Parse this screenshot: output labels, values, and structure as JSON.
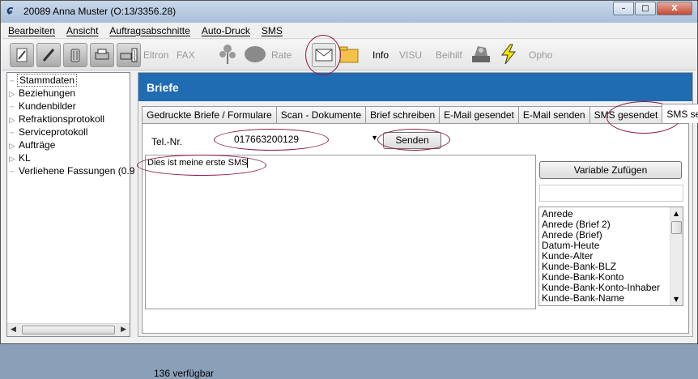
{
  "window": {
    "icon": "ɕ",
    "title": "20089  Anna Muster   (O:13/3356.28)",
    "minimize": "–",
    "maximize": "□",
    "close": "X"
  },
  "menu": [
    "Bearbeiten",
    "Ansicht",
    "Auftragsabschnitte",
    "Auto-Druck",
    "SMS"
  ],
  "toolbar": {
    "elton": "Eltron",
    "fax": "FAX",
    "rate": "Rate",
    "info": "Info",
    "visu": "VISU",
    "beihilf": "Beihilf",
    "opho": "Opho"
  },
  "tree": [
    {
      "label": "Stammdaten",
      "expandable": false,
      "selected": true
    },
    {
      "label": "Beziehungen",
      "expandable": true
    },
    {
      "label": "Kundenbilder",
      "expandable": false
    },
    {
      "label": "Refraktionsprotokoll",
      "expandable": true
    },
    {
      "label": "Serviceprotokoll",
      "expandable": false
    },
    {
      "label": "Aufträge",
      "expandable": true
    },
    {
      "label": "KL",
      "expandable": true
    },
    {
      "label": "Verliehene Fassungen (0.9",
      "expandable": false
    }
  ],
  "header": {
    "title": "Briefe"
  },
  "tabs": [
    "Gedruckte Briefe / Formulare",
    "Scan - Dokumente",
    "Brief schreiben",
    "E-Mail gesendet",
    "E-Mail senden",
    "SMS gesendet",
    "SMS senden"
  ],
  "active_tab": "SMS senden",
  "sms": {
    "tel_label": "Tel.-Nr.",
    "tel_value": "017663200129",
    "send_label": "Senden",
    "message": "Dies ist meine erste SMS",
    "var_button": "Variable Zufügen",
    "variables": [
      "Anrede",
      "Anrede (Brief 2)",
      "Anrede (Brief)",
      "Datum-Heute",
      "Kunde-Alter",
      "Kunde-Bank-BLZ",
      "Kunde-Bank-Konto",
      "Kunde-Bank-Konto-Inhaber",
      "Kunde-Bank-Name"
    ],
    "status": "136 verfügbar"
  },
  "colors": {
    "header_bg": "#1f6cb3",
    "annotation": "#8b1a4a"
  }
}
